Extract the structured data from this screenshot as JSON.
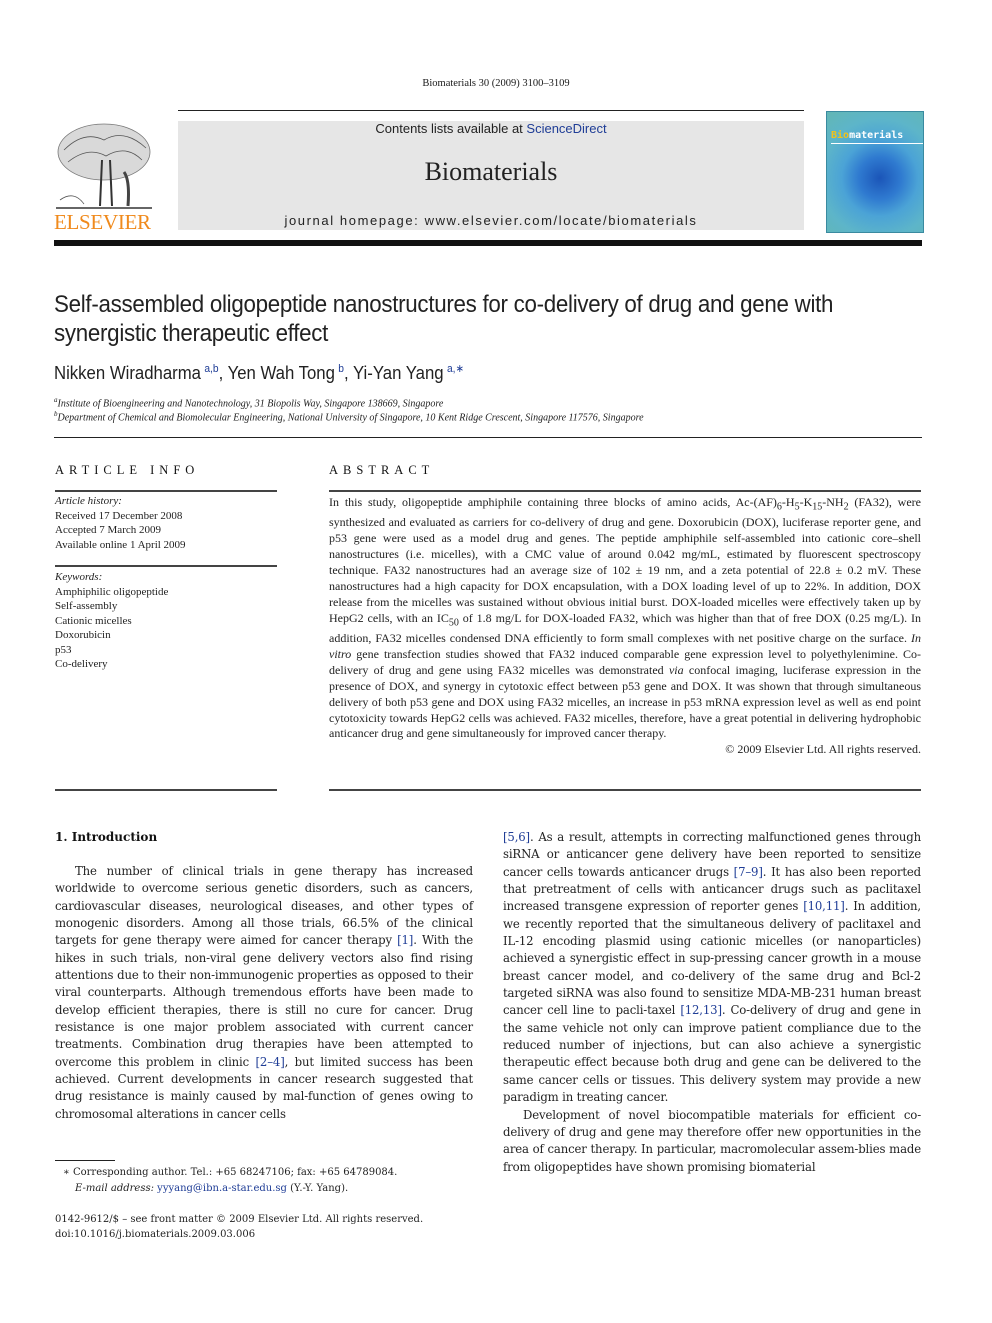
{
  "header": {
    "running_head": "Biomaterials 30 (2009) 3100–3109",
    "contents_prefix": "Contents lists available at ",
    "contents_link": "ScienceDirect",
    "journal_title": "Biomaterials",
    "homepage": "journal homepage: www.elsevier.com/locate/biomaterials",
    "publisher_logo_text": "ELSEVIER",
    "cover_title_accent": "Bio",
    "cover_title_rest": "materials"
  },
  "article": {
    "title_line1": "Self-assembled oligopeptide nanostructures for co-delivery of drug and gene with",
    "title_line2": "synergistic therapeutic effect",
    "authors": [
      {
        "name": "Nikken Wiradharma",
        "sup": "a,b"
      },
      {
        "name": "Yen Wah Tong",
        "sup": "b"
      },
      {
        "name": "Yi-Yan Yang",
        "sup": "a,∗"
      }
    ],
    "affiliations": [
      {
        "mark": "a",
        "text": "Institute of Bioengineering and Nanotechnology, 31 Biopolis Way, Singapore 138669, Singapore"
      },
      {
        "mark": "b",
        "text": "Department of Chemical and Biomolecular Engineering, National University of Singapore, 10 Kent Ridge Crescent, Singapore 117576, Singapore"
      }
    ]
  },
  "article_info": {
    "heading": "ARTICLE INFO",
    "history_label": "Article history:",
    "history": [
      "Received 17 December 2008",
      "Accepted 7 March 2009",
      "Available online 1 April 2009"
    ],
    "keywords_label": "Keywords:",
    "keywords": [
      "Amphiphilic oligopeptide",
      "Self-assembly",
      "Cationic micelles",
      "Doxorubicin",
      "p53",
      "Co-delivery"
    ]
  },
  "abstract": {
    "heading": "ABSTRACT",
    "p1_a": "In this study, oligopeptide amphiphile containing three blocks of amino acids, Ac-(AF)",
    "sub_6": "6",
    "p1_b": "-H",
    "sub_5": "5",
    "p1_c": "-K",
    "sub_15": "15",
    "p1_d": "-NH",
    "sub_2": "2",
    "p1_e": " (FA32), were synthesized and evaluated as carriers for co-delivery of drug and gene. Doxorubicin (DOX), luciferase reporter gene, and p53 gene were used as a model drug and genes. The peptide amphiphile self-assembled into cationic core–shell nanostructures (i.e. micelles), with a CMC value of around 0.042 mg/mL, estimated by fluorescent spectroscopy technique. FA32 nanostructures had an average size of 102 ± 19 nm, and a zeta potential of 22.8 ± 0.2 mV. These nanostructures had a high capacity for DOX encapsulation, with a DOX loading level of up to 22%. In addition, DOX release from the micelles was sustained without obvious initial burst. DOX-loaded micelles were effectively taken up by HepG2 cells, with an IC",
    "sub_50": "50",
    "p1_f": " of 1.8 mg/L for DOX-loaded FA32, which was higher than that of free DOX (0.25 mg/L). In addition, FA32 micelles condensed DNA efficiently to form small complexes with net positive charge on the surface. ",
    "italic_invitro": "In vitro",
    "p1_g": " gene transfection studies showed that FA32 induced comparable gene expression level to polyethylenimine. Co-delivery of drug and gene using FA32 micelles was demonstrated ",
    "italic_via": "via",
    "p1_h": " confocal imaging, luciferase expression in the presence of DOX, and synergy in cytotoxic effect between p53 gene and DOX. It was shown that through simultaneous delivery of both p53 gene and DOX using FA32 micelles, an increase in p53 mRNA expression level as well as end point cytotoxicity towards HepG2 cells was achieved. FA32 micelles, therefore, have a great potential in delivering hydrophobic anticancer drug and gene simultaneously for improved cancer therapy.",
    "copyright": "© 2009 Elsevier Ltd. All rights reserved."
  },
  "introduction": {
    "heading": "1.  Introduction",
    "left_a": "The number of clinical trials in gene therapy has increased worldwide to overcome serious genetic disorders, such as cancers, cardiovascular diseases, neurological diseases, and other types of monogenic disorders. Among all those trials, 66.5% of the clinical targets for gene therapy were aimed for cancer therapy ",
    "ref_1": "[1]",
    "left_b": ". With the hikes in such trials, non-viral gene delivery vectors also find rising attentions due to their non-immunogenic properties as opposed to their viral counterparts. Although tremendous efforts have been made to develop efficient therapies, there is still no cure for cancer. Drug resistance is one major problem associated with current cancer treatments. Combination drug therapies have been attempted to overcome this problem in clinic ",
    "ref_2_4": "[2–4]",
    "left_c": ", but limited success has been achieved. Current developments in cancer research suggested that drug resistance is mainly caused by mal-function of genes owing to chromosomal alterations in cancer cells",
    "ref_5_6": "[5,6]",
    "right_a": ". As a result, attempts in correcting malfunctioned genes through siRNA or anticancer gene delivery have been reported to sensitize cancer cells towards anticancer drugs ",
    "ref_7_9": "[7–9]",
    "right_b": ". It has also been reported that pretreatment of cells with anticancer drugs such as paclitaxel increased transgene expression of reporter genes ",
    "ref_10_11": "[10,11]",
    "right_c": ". In addition, we recently reported that the simultaneous delivery of paclitaxel and IL-12 encoding plasmid using cationic micelles (or nanoparticles) achieved a synergistic effect in sup-pressing cancer growth in a mouse breast cancer model, and co-delivery of the same drug and Bcl-2 targeted siRNA was also found to sensitize MDA-MB-231 human breast cancer cell line to pacli-taxel ",
    "ref_12_13": "[12,13]",
    "right_d": ". Co-delivery of drug and gene in the same vehicle not only can improve patient compliance due to the reduced number of injections, but can also achieve a synergistic therapeutic effect because both drug and gene can be delivered to the same cancer cells or tissues. This delivery system may provide a new paradigm in treating cancer.",
    "right_p2": "Development of novel biocompatible materials for efficient co-delivery of drug and gene may therefore offer new opportunities in the area of cancer therapy. In particular, macromolecular assem-blies made from oligopeptides have shown promising biomaterial"
  },
  "footnotes": {
    "corresponding": "∗  Corresponding author. Tel.: +65 68247106; fax: +65 64789084.",
    "email_label": "E-mail address: ",
    "email": "yyyang@ibn.a-star.edu.sg",
    "email_suffix": " (Y.-Y. Yang).",
    "front_matter": "0142-9612/$ – see front matter © 2009 Elsevier Ltd. All rights reserved.",
    "doi": "doi:10.1016/j.biomaterials.2009.03.006"
  }
}
